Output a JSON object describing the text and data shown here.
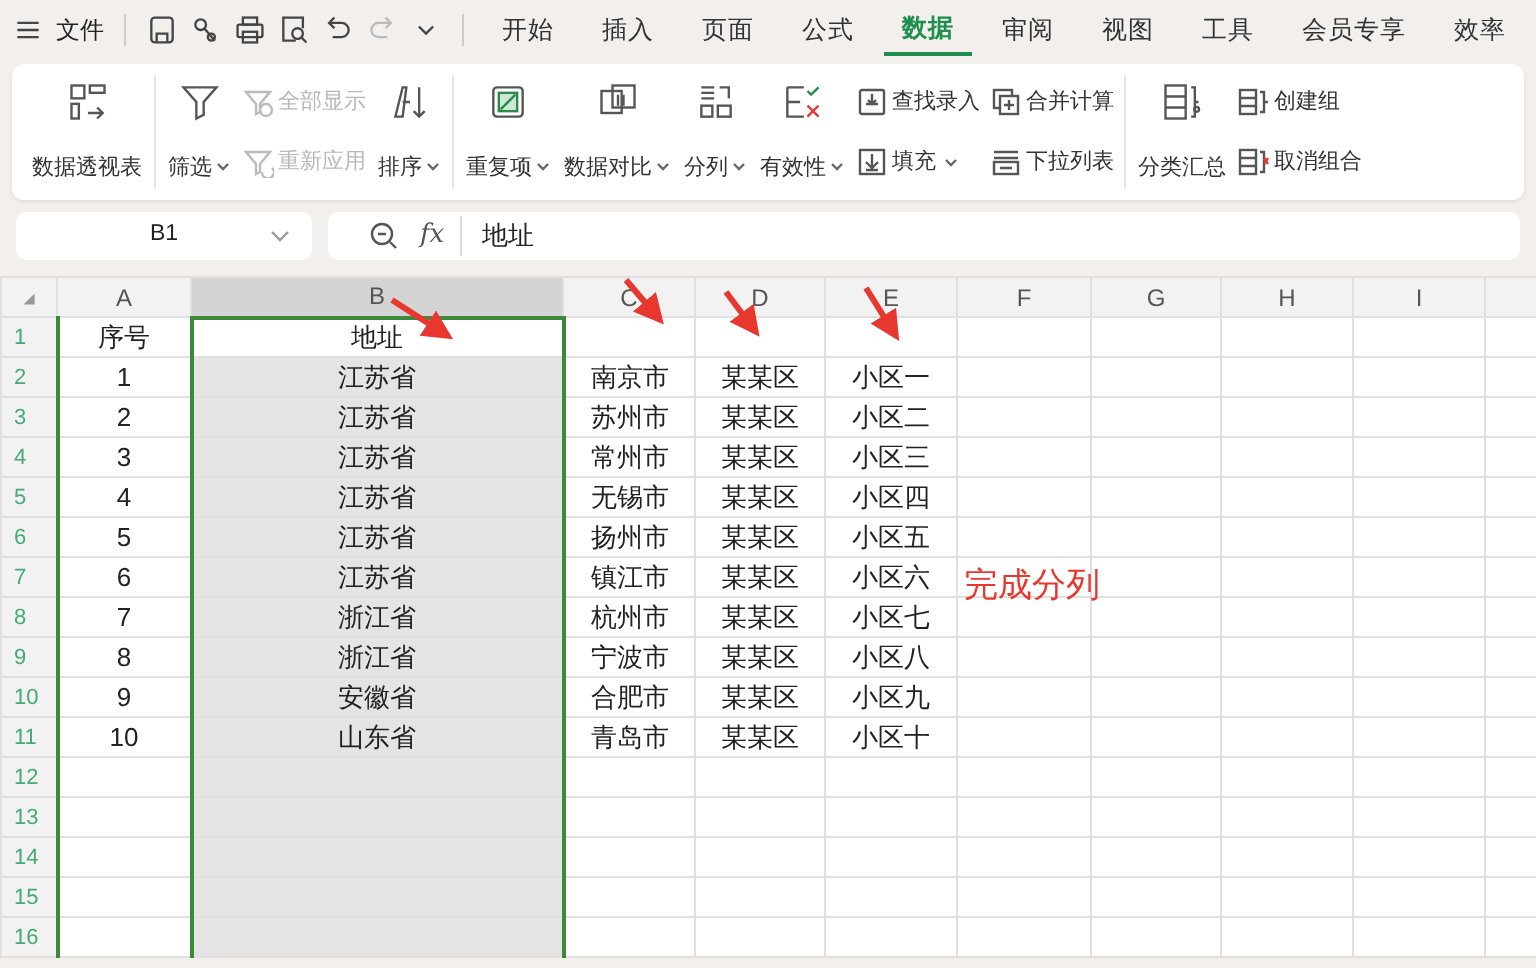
{
  "menu_bar": {
    "file": "文件",
    "tabs": [
      {
        "label": "开始",
        "selected": false
      },
      {
        "label": "插入",
        "selected": false
      },
      {
        "label": "页面",
        "selected": false
      },
      {
        "label": "公式",
        "selected": false
      },
      {
        "label": "数据",
        "selected": true
      },
      {
        "label": "审阅",
        "selected": false
      },
      {
        "label": "视图",
        "selected": false
      },
      {
        "label": "工具",
        "selected": false
      },
      {
        "label": "会员专享",
        "selected": false
      },
      {
        "label": "效率",
        "selected": false
      }
    ]
  },
  "ribbon": {
    "groups": [
      [
        {
          "kind": "large",
          "label": "数据透视表",
          "dropdown": false
        }
      ],
      [
        {
          "kind": "large",
          "label": "筛选",
          "dropdown": true
        },
        {
          "kind": "stack",
          "items": [
            {
              "label": "全部显示",
              "disabled": true,
              "dropdown": false
            },
            {
              "label": "重新应用",
              "disabled": true,
              "dropdown": false
            }
          ]
        },
        {
          "kind": "large",
          "label": "排序",
          "dropdown": true
        }
      ],
      [
        {
          "kind": "large",
          "label": "重复项",
          "dropdown": true
        },
        {
          "kind": "large",
          "label": "数据对比",
          "dropdown": true
        },
        {
          "kind": "large",
          "label": "分列",
          "dropdown": true
        },
        {
          "kind": "large",
          "label": "有效性",
          "dropdown": true
        },
        {
          "kind": "stack",
          "items": [
            {
              "label": "查找录入",
              "disabled": false,
              "dropdown": false
            },
            {
              "label": "填充",
              "disabled": false,
              "dropdown": true
            }
          ]
        },
        {
          "kind": "stack",
          "items": [
            {
              "label": "合并计算",
              "disabled": false,
              "dropdown": false
            },
            {
              "label": "下拉列表",
              "disabled": false,
              "dropdown": false
            }
          ]
        }
      ],
      [
        {
          "kind": "large",
          "label": "分类汇总",
          "dropdown": false
        },
        {
          "kind": "stack",
          "items": [
            {
              "label": "创建组",
              "disabled": false,
              "dropdown": false
            },
            {
              "label": "取消组合",
              "disabled": false,
              "dropdown": false
            }
          ]
        }
      ]
    ]
  },
  "formula_bar": {
    "cell_reference": "B1",
    "fx": "fx",
    "value": "地址"
  },
  "sheet": {
    "columns": [
      {
        "label": "A",
        "selected": false
      },
      {
        "label": "B",
        "selected": true
      },
      {
        "label": "C",
        "selected": false
      },
      {
        "label": "D",
        "selected": false
      },
      {
        "label": "E",
        "selected": false
      },
      {
        "label": "F",
        "selected": false
      },
      {
        "label": "G",
        "selected": false
      },
      {
        "label": "H",
        "selected": false
      },
      {
        "label": "I",
        "selected": false
      }
    ],
    "rows": [
      {
        "number": "1",
        "cells": [
          "序号",
          "地址",
          "",
          "",
          ""
        ]
      },
      {
        "number": "2",
        "cells": [
          "1",
          "江苏省",
          "南京市",
          "某某区",
          "小区一"
        ]
      },
      {
        "number": "3",
        "cells": [
          "2",
          "江苏省",
          "苏州市",
          "某某区",
          "小区二"
        ]
      },
      {
        "number": "4",
        "cells": [
          "3",
          "江苏省",
          "常州市",
          "某某区",
          "小区三"
        ]
      },
      {
        "number": "5",
        "cells": [
          "4",
          "江苏省",
          "无锡市",
          "某某区",
          "小区四"
        ]
      },
      {
        "number": "6",
        "cells": [
          "5",
          "江苏省",
          "扬州市",
          "某某区",
          "小区五"
        ]
      },
      {
        "number": "7",
        "cells": [
          "6",
          "江苏省",
          "镇江市",
          "某某区",
          "小区六"
        ]
      },
      {
        "number": "8",
        "cells": [
          "7",
          "浙江省",
          "杭州市",
          "某某区",
          "小区七"
        ]
      },
      {
        "number": "9",
        "cells": [
          "8",
          "浙江省",
          "宁波市",
          "某某区",
          "小区八"
        ]
      },
      {
        "number": "10",
        "cells": [
          "9",
          "安徽省",
          "合肥市",
          "某某区",
          "小区九"
        ]
      },
      {
        "number": "11",
        "cells": [
          "10",
          "山东省",
          "青岛市",
          "某某区",
          "小区十"
        ]
      },
      {
        "number": "12",
        "cells": []
      },
      {
        "number": "13",
        "cells": []
      },
      {
        "number": "14",
        "cells": []
      },
      {
        "number": "15",
        "cells": []
      },
      {
        "number": "16",
        "cells": []
      }
    ],
    "annotation": "完成分列"
  }
}
